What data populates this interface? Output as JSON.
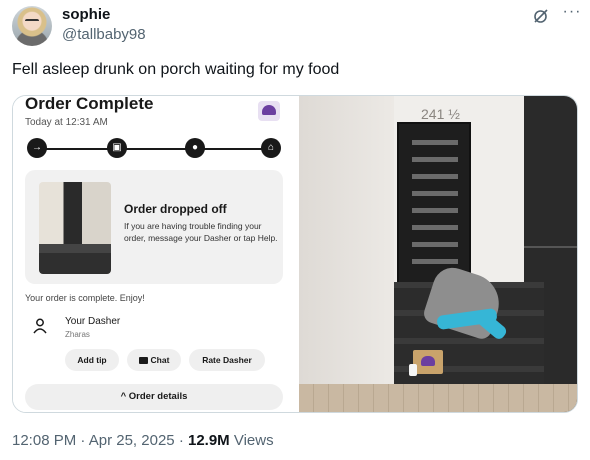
{
  "author": {
    "name": "sophie",
    "handle": "@tallbaby98"
  },
  "tweet": {
    "text": "Fell asleep drunk on porch waiting for my food"
  },
  "order_screenshot": {
    "title": "Order Complete",
    "time": "Today at 12:31 AM",
    "card_title": "Order dropped off",
    "card_message": "If you are having trouble finding your order, message your Dasher or tap Help.",
    "complete_text": "Your order is complete. Enjoy!",
    "dasher_label": "Your Dasher",
    "dasher_name": "Zharas",
    "buttons": {
      "add_tip": "Add tip",
      "chat": "Chat",
      "rate": "Rate Dasher"
    },
    "details_label": "^ Order details"
  },
  "photo": {
    "house_number": "241 ½"
  },
  "meta": {
    "time": "12:08 PM",
    "date": "Apr 25, 2025",
    "separator": "·",
    "views": "12.9M",
    "views_label": "Views"
  },
  "icons": {
    "grok": "grok-icon",
    "more": "more-icon",
    "order_steps": [
      "store-icon",
      "bag-icon",
      "car-icon",
      "home-icon"
    ]
  },
  "colors": {
    "text_primary": "#0f1419",
    "text_secondary": "#536471",
    "border": "#cfd9de",
    "brand_purple": "#6b3fa0"
  }
}
